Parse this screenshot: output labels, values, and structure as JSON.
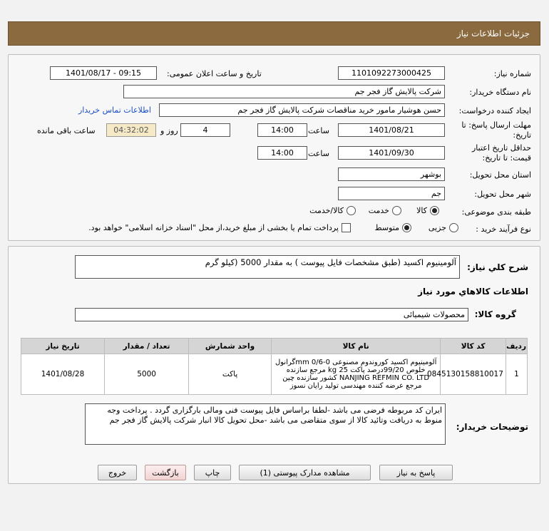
{
  "header": {
    "title": "جزئیات اطلاعات نیاز"
  },
  "info": {
    "need_number_label": "شماره نیاز:",
    "need_number": "1101092273000425",
    "announce_label": "تاریخ و ساعت اعلان عمومی:",
    "announce_value": "1401/08/17 - 09:15",
    "buyer_label": "نام دستگاه خریدار:",
    "buyer_value": "شرکت پالایش گاز فجر جم",
    "creator_label": "ایجاد کننده درخواست:",
    "creator_value": "حسن هوشیار مامور خرید مناقصات شرکت پالایش گاز فجر جم",
    "contact_link": "اطلاعات تماس خریدار",
    "reply_deadline_label_1": "مهلت ارسال پاسخ: تا",
    "reply_deadline_label_2": "تاریخ:",
    "reply_date": "1401/08/21",
    "time_label": "ساعت",
    "reply_time": "14:00",
    "days_value": "4",
    "days_label": "روز و",
    "remaining_time": "04:32:02",
    "remaining_label": "ساعت باقی مانده",
    "validity_label_1": "حداقل تاریخ اعتبار",
    "validity_label_2": "قیمت: تا تاریخ:",
    "validity_date": "1401/09/30",
    "validity_time": "14:00",
    "province_label": "استان محل تحویل:",
    "province_value": "بوشهر",
    "city_label": "شهر محل تحویل:",
    "city_value": "جم",
    "category_label": "طبقه بندی موضوعی:",
    "category_options": [
      "کالا",
      "خدمت",
      "کالا/خدمت"
    ],
    "category_selected": "کالا",
    "process_label": "نوع فرآیند خرید :",
    "process_options": [
      "جزیی",
      "متوسط"
    ],
    "process_selected": "متوسط",
    "payment_note": "پرداخت تمام یا بخشی از مبلغ خرید،از محل \"اسناد خزانه اسلامی\" خواهد بود."
  },
  "details": {
    "summary_label": "شرح کلي نياز:",
    "summary_value": "آلومینیوم اکسید (طبق مشخصات فایل پیوست ) به مقدار 5000 (کیلو گرم",
    "goods_info_label": "اطلاعات کالاهاي مورد نياز",
    "group_label": "گروه کالا:",
    "group_value": "محصولات شیمیائی",
    "table": {
      "headers": [
        "ردیف",
        "کد کالا",
        "نام کالا",
        "واحد شمارش",
        "تعداد / مقدار",
        "تاریخ نیاز"
      ],
      "rows": [
        {
          "row": "1",
          "code": "0845130158810017",
          "name": "آلومینیوم اکسید کوروندوم مصنوعی mm 0/6-0گرانول خلوص 99/20درصد پاکت 25 kg مرجع سازنده NANJING REFMIN CO. LTD کشور سازنده چین مرجع عرضه کننده مهندسی تولید رایان نسوز",
          "unit": "پاکت",
          "qty": "5000",
          "date": "1401/08/28"
        }
      ]
    },
    "buyer_notes_label": "توضیحات خریدار:",
    "buyer_notes": "ایران کد مربوطه فرضی می باشد -لطفا براساس فایل پیوست فنی ومالی بارگزاری گردد . پرداخت وجه منوط به دریافت وتائید کالا از سوی متقاضی می باشد -محل تحویل کالا انبار شرکت پالایش گاز فجر جم"
  },
  "buttons": {
    "reply": "پاسخ به نیاز",
    "attachments": "مشاهده مدارک پیوستی (1)",
    "print": "چاپ",
    "back": "بازگشت",
    "exit": "خروج"
  }
}
